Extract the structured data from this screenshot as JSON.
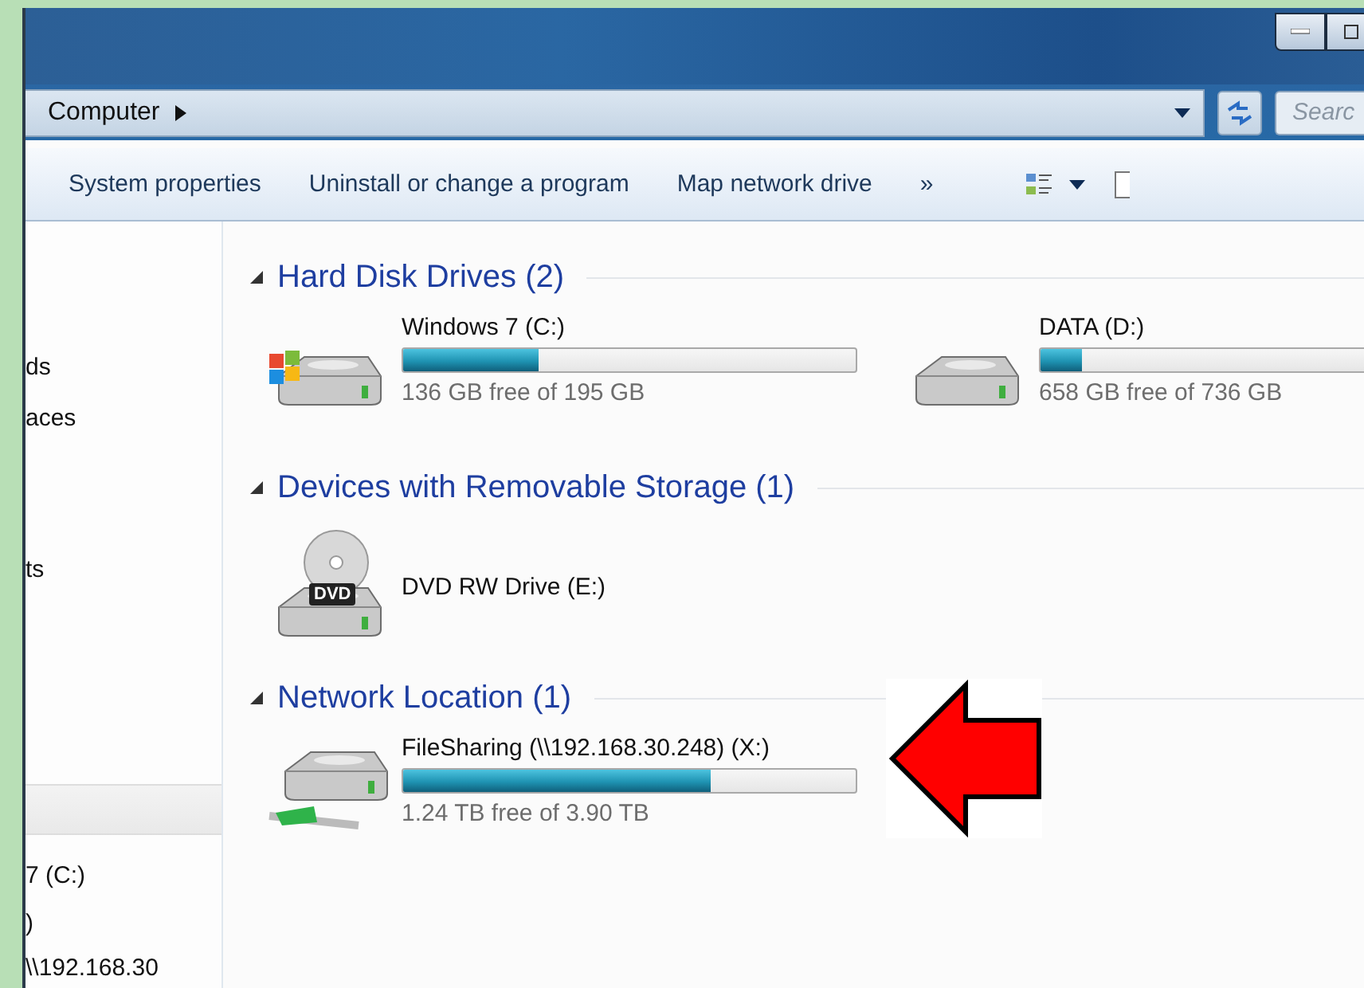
{
  "address": {
    "path": [
      "Computer"
    ]
  },
  "search": {
    "placeholder": "Searc"
  },
  "toolbar": {
    "items": [
      "System properties",
      "Uninstall or change a program",
      "Map network drive"
    ],
    "overflow": "»"
  },
  "nav": {
    "items": [
      {
        "kind": "text",
        "label": "ds"
      },
      {
        "kind": "text",
        "label": "aces"
      },
      {
        "kind": "text",
        "label": "ts"
      },
      {
        "kind": "header"
      },
      {
        "kind": "text",
        "label": "7 (C:)"
      },
      {
        "kind": "text",
        "label": ")"
      },
      {
        "kind": "text",
        "label": "\\\\192.168.30"
      }
    ]
  },
  "groups": [
    {
      "title": "Hard Disk Drives (2)",
      "expanded": true,
      "drives": [
        {
          "kind": "windows",
          "name": "Windows 7 (C:)",
          "level": 0.3,
          "free": "136 GB free of 195 GB"
        },
        {
          "kind": "disk",
          "name": "DATA (D:)",
          "level": 0.11,
          "free": "658 GB free of 736 GB"
        }
      ]
    },
    {
      "title": "Devices with Removable Storage (1)",
      "expanded": true,
      "drives": [
        {
          "kind": "dvd",
          "name": "DVD RW Drive (E:)",
          "badge": "DVD"
        }
      ]
    },
    {
      "title": "Network Location (1)",
      "expanded": true,
      "drives": [
        {
          "kind": "network",
          "name": "FileSharing (\\\\192.168.30.248) (X:)",
          "level": 0.68,
          "free": "1.24 TB free of 3.90 TB"
        }
      ]
    }
  ]
}
